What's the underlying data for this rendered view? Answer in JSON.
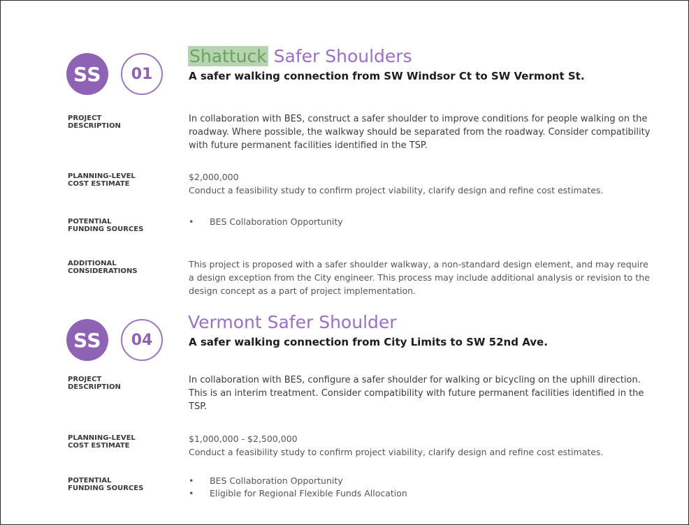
{
  "projects": [
    {
      "badge": "SS",
      "number": "01",
      "title_highlight": "Shattuck",
      "title_rest": " Safer Shoulders",
      "subtitle": "A safer walking connection from SW Windsor Ct to SW Vermont St.",
      "rows": [
        {
          "label_line1": "PROJECT",
          "label_line2": "DESCRIPTION",
          "text": "In collaboration with BES, construct a safer shoulder to improve conditions for people walking on the roadway. Where possible, the walkway should be separated from the roadway. Consider compatibility with future permanent facilities identified in the TSP."
        },
        {
          "label_line1": "PLANNING-LEVEL",
          "label_line2": "COST ESTIMATE",
          "cost": "$2,000,000",
          "text": "Conduct a feasibility study to confirm project viability, clarify design and refine cost estimates."
        },
        {
          "label_line1": "POTENTIAL",
          "label_line2": "FUNDING SOURCES",
          "bullets": [
            "BES Collaboration Opportunity"
          ]
        },
        {
          "label_line1": "ADDITIONAL",
          "label_line2": "CONSIDERATIONS",
          "text": "This project is proposed with a safer shoulder walkway, a non-standard design element, and may require a design exception from the City engineer. This process may include additional analysis or revision to the design concept as a part of project implementation."
        }
      ]
    },
    {
      "badge": "SS",
      "number": "04",
      "title_highlight": "",
      "title_rest": "Vermont Safer Shoulder",
      "subtitle": "A safer walking connection from City Limits to SW 52nd Ave.",
      "rows": [
        {
          "label_line1": "PROJECT",
          "label_line2": "DESCRIPTION",
          "text": "In collaboration with BES, configure a safer shoulder for walking or bicycling on the uphill direction. This is an interim treatment. Consider compatibility with future permanent facilities identified in the TSP."
        },
        {
          "label_line1": "PLANNING-LEVEL",
          "label_line2": "COST ESTIMATE",
          "cost": "$1,000,000 - $2,500,000",
          "text": "Conduct a feasibility study to confirm project viability, clarify design and refine cost estimates."
        },
        {
          "label_line1": "POTENTIAL",
          "label_line2": "FUNDING SOURCES",
          "bullets": [
            "BES Collaboration Opportunity",
            "Eligible for Regional Flexible Funds Allocation"
          ]
        }
      ]
    }
  ],
  "bullet_glyph": "•",
  "colors": {
    "accent": "#8e63b5",
    "highlight": "#b7d4b0"
  }
}
